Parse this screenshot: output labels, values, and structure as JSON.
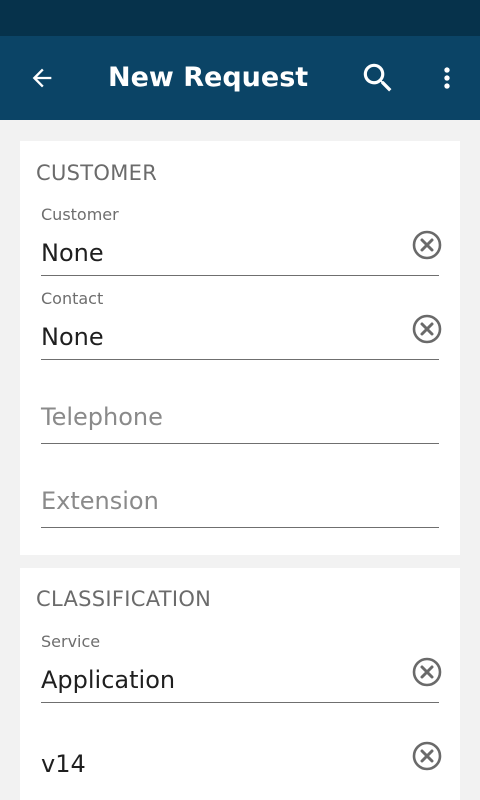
{
  "header": {
    "title": "New Request",
    "back_icon": "arrow-left-icon",
    "search_icon": "search-icon",
    "more_icon": "more-vert-icon"
  },
  "customer_section": {
    "title": "CUSTOMER",
    "customer": {
      "label": "Customer",
      "value": "None"
    },
    "contact": {
      "label": "Contact",
      "value": "None"
    },
    "telephone": {
      "placeholder": "Telephone"
    },
    "extension": {
      "placeholder": "Extension"
    }
  },
  "classification_section": {
    "title": "CLASSIFICATION",
    "service": {
      "label": "Service",
      "value": "Application"
    },
    "version": {
      "value": "v14"
    }
  },
  "colors": {
    "status_bar": "#06324b",
    "app_bar": "#0b4466",
    "background": "#f2f2f2",
    "card": "#ffffff",
    "clear_icon": "#6a6a6a"
  }
}
